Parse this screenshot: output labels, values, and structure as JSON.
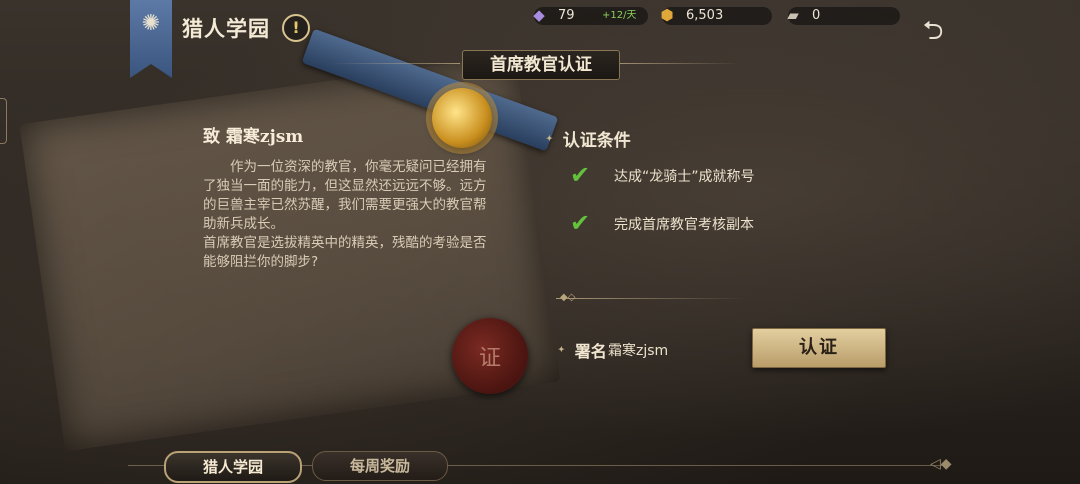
{
  "app": {
    "title": "猎人学园",
    "info_icon": "!"
  },
  "resources": [
    {
      "icon": "crystal-icon",
      "value": "79",
      "rate": "+12/天"
    },
    {
      "icon": "gold-coin-icon",
      "value": "6,503"
    },
    {
      "icon": "ticket-icon",
      "value": "0"
    }
  ],
  "section": {
    "title": "首席教官认证"
  },
  "letter": {
    "addressee": "致 霜寒zjsm",
    "paragraphs": [
      "作为一位资深的教官，你毫无疑问已经拥有了独当一面的能力，但这显然还远远不够。远方的巨兽主宰已然苏醒，我们需要更强大的教官帮助新兵成长。",
      "首席教官是选拔精英中的精英，残酷的考验是否能够阻拦你的脚步?"
    ],
    "seal_text": "证"
  },
  "conditions": {
    "title": "认证条件",
    "items": [
      {
        "text": "达成“龙骑士”成就称号",
        "done": true
      },
      {
        "text": "完成首席教官考核副本",
        "done": true
      }
    ]
  },
  "signature": {
    "label": "署名",
    "name": "霜寒zjsm"
  },
  "actions": {
    "certify_label": "认证"
  },
  "tabs": [
    {
      "label": "猎人学园",
      "active": true
    },
    {
      "label": "每周奖励",
      "active": false
    }
  ],
  "colors": {
    "accent_gold": "#d8c48e",
    "check_green": "#62c23c",
    "banner_blue": "#4f6a96"
  }
}
